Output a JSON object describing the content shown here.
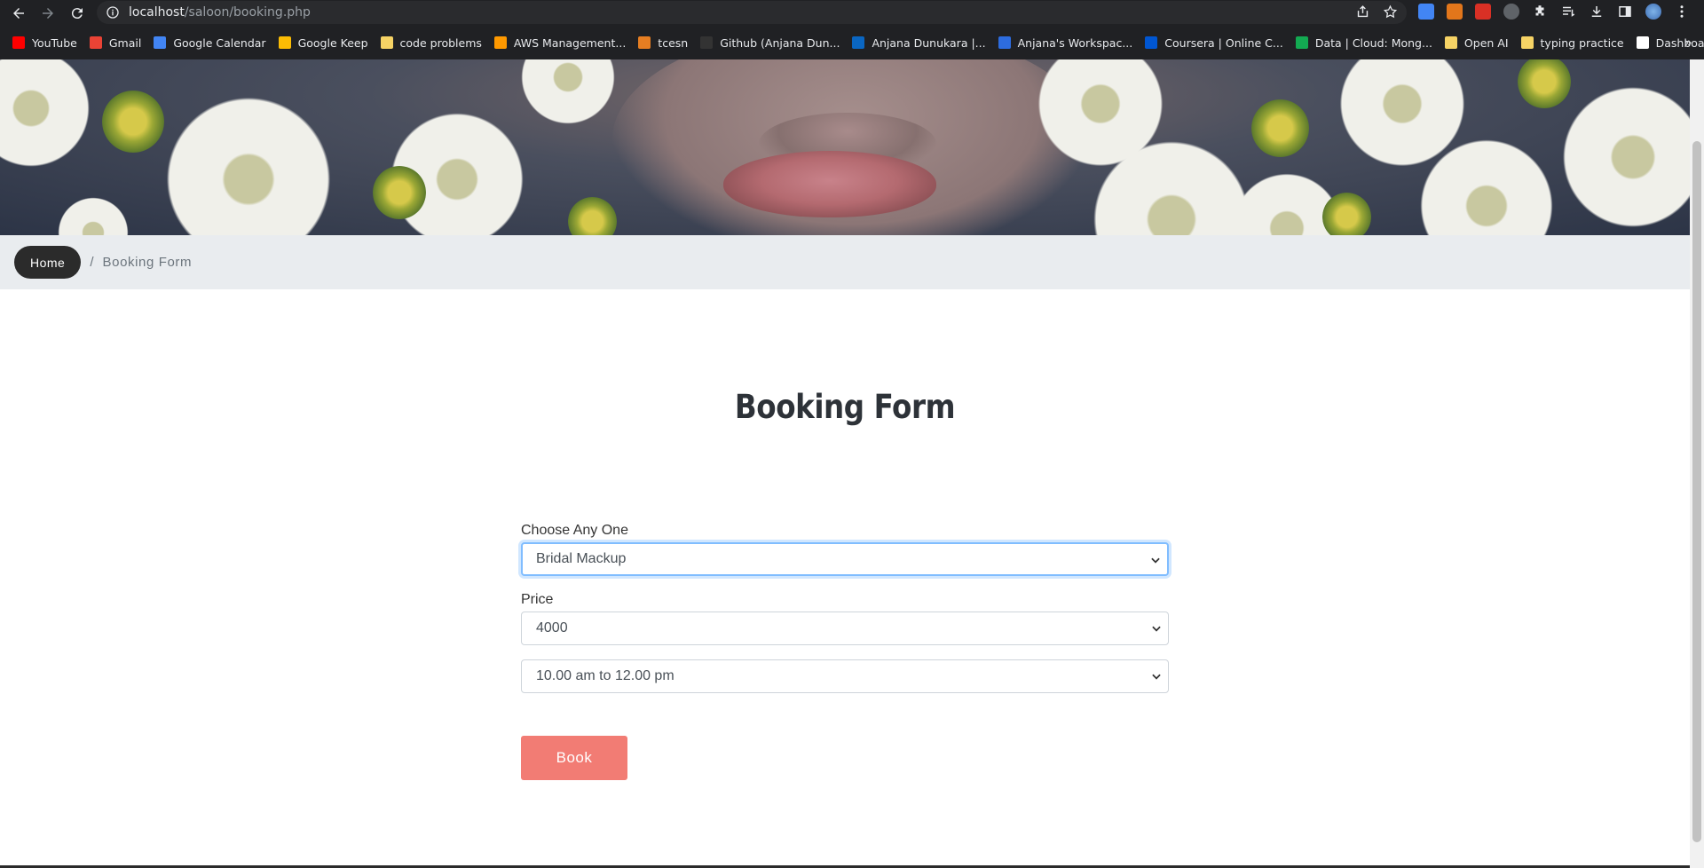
{
  "browser": {
    "url_host": "localhost",
    "url_path": "/saloon/booking.php",
    "bookmarks": [
      {
        "label": "YouTube",
        "color": "#ff0000"
      },
      {
        "label": "Gmail",
        "color": "#ea4335"
      },
      {
        "label": "Google Calendar",
        "color": "#4285f4"
      },
      {
        "label": "Google Keep",
        "color": "#fbbc04"
      },
      {
        "label": "code problems",
        "color": "#f6d365"
      },
      {
        "label": "AWS Management...",
        "color": "#ff9900"
      },
      {
        "label": "tcesn",
        "color": "#e67e22"
      },
      {
        "label": "Github (Anjana Dun...",
        "color": "#333333"
      },
      {
        "label": "Anjana Dunukara |...",
        "color": "#0a66c2"
      },
      {
        "label": "Anjana's Workspac...",
        "color": "#2d6cdf"
      },
      {
        "label": "Coursera | Online C...",
        "color": "#0056d2"
      },
      {
        "label": "Data | Cloud: Mong...",
        "color": "#13aa52"
      },
      {
        "label": "Open AI",
        "color": "#f6d365"
      },
      {
        "label": "typing practice",
        "color": "#f6d365"
      },
      {
        "label": "Dashboard – Vercel",
        "color": "#ffffff"
      }
    ],
    "more": "»"
  },
  "breadcrumb": {
    "home": "Home",
    "separator": "/",
    "current": "Booking Form"
  },
  "page": {
    "title": "Booking Form"
  },
  "form": {
    "service_label": "Choose Any One",
    "service_value": "Bridal Mackup",
    "price_label": "Price",
    "price_value": "4000",
    "time_value": "10.00 am to 12.00 pm",
    "submit_label": "Book"
  }
}
